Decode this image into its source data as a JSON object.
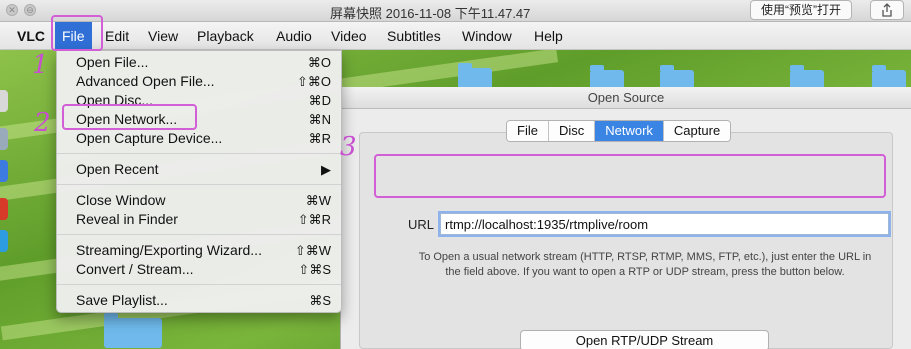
{
  "preview_bar": {
    "title": "屏幕快照 2016-11-08 下午11.47.47",
    "open_with_label": "使用“预览”打开",
    "share_icon": "share-icon",
    "close_glyph": "✕",
    "minimize_glyph": "⊖"
  },
  "menubar": {
    "app_name": "VLC",
    "items": [
      "File",
      "Edit",
      "View",
      "Playback",
      "Audio",
      "Video",
      "Subtitles",
      "Window",
      "Help"
    ]
  },
  "file_menu": {
    "items": [
      {
        "label": "Open File...",
        "shortcut": "⌘O"
      },
      {
        "label": "Advanced Open File...",
        "shortcut": "⇧⌘O"
      },
      {
        "label": "Open Disc...",
        "shortcut": "⌘D"
      },
      {
        "label": "Open Network...",
        "shortcut": "⌘N"
      },
      {
        "label": "Open Capture Device...",
        "shortcut": "⌘R"
      },
      {
        "label": "Open Recent",
        "shortcut": "▶"
      },
      {
        "label": "Close Window",
        "shortcut": "⌘W"
      },
      {
        "label": "Reveal in Finder",
        "shortcut": "⇧⌘R"
      },
      {
        "label": "Streaming/Exporting Wizard...",
        "shortcut": "⇧⌘W"
      },
      {
        "label": "Convert / Stream...",
        "shortcut": "⇧⌘S"
      },
      {
        "label": "Save Playlist...",
        "shortcut": "⌘S"
      }
    ]
  },
  "dialog": {
    "title": "Open Source",
    "tabs": [
      "File",
      "Disc",
      "Network",
      "Capture"
    ],
    "selected_tab": "Network",
    "url_label": "URL",
    "url_value": "rtmp://localhost:1935/rtmplive/room",
    "hint_line1": "To Open a usual network stream (HTTP, RTSP, RTMP, MMS, FTP, etc.), just enter the URL in",
    "hint_line2": "the field above. If you want to open a RTP or UDP stream, press the button below.",
    "rtp_button": "Open RTP/UDP Stream"
  },
  "annotations": {
    "step1": "1",
    "step2": "2",
    "step3": "3",
    "color": "#d35fd6"
  },
  "colors": {
    "menu_highlight": "#2f6fd6",
    "tab_selected": "#3a84e4"
  }
}
